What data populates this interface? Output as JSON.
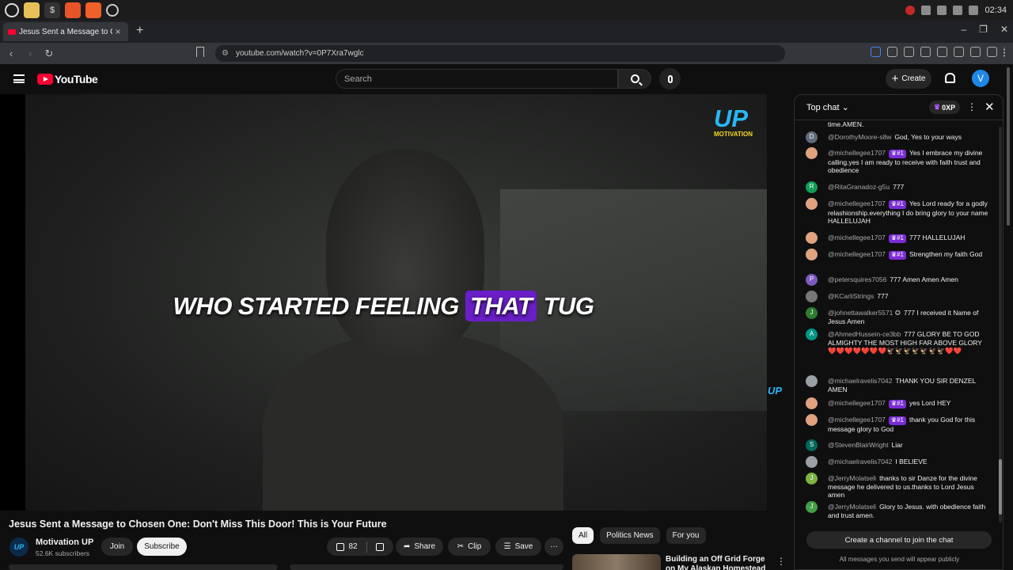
{
  "os": {
    "clock": "02:34"
  },
  "browser": {
    "tab_title": "Jesus Sent a Message to C",
    "tab_close": "×",
    "new_tab": "+",
    "url": "youtube.com/watch?v=0P7Xra7wglc",
    "win_min": "–",
    "win_max": "❐",
    "win_close": "✕"
  },
  "youtube": {
    "logo_text": "YouTube",
    "search_placeholder": "Search",
    "create_label": "Create",
    "avatar_letter": "V"
  },
  "video": {
    "caption_before": "WHO STARTED FEELING ",
    "caption_highlight": "THAT",
    "caption_after": " TUG",
    "watermark_main": "UP",
    "watermark_sub": "MOTIVATION",
    "watermark_small": "UP",
    "title": "Jesus Sent a Message to Chosen One: Don't Miss This Door! This is Your Future"
  },
  "channel": {
    "avatar_text": "UP",
    "name": "Motivation UP",
    "subscribers": "52.6K subscribers",
    "join_label": "Join",
    "subscribe_label": "Subscribe"
  },
  "actions": {
    "likes": "82",
    "share_label": "Share",
    "clip_label": "Clip",
    "save_label": "Save",
    "more": "···"
  },
  "chips": [
    "All",
    "Politics News",
    "For you"
  ],
  "recommendation": {
    "title": "Building an Off Grid Forge on My Alaskan Homestead",
    "more": "⋮"
  },
  "chat": {
    "header_label": "Top chat",
    "points": "0XP",
    "kebab": "⋮",
    "close": "✕",
    "top_fragment": "time.AMEN.",
    "messages": [
      {
        "avatar": "D",
        "author": "@DorothyMoore-s8w",
        "badge": "",
        "text": "God, Yes to your ways"
      },
      {
        "avatar": "",
        "author": "@michellegee1707",
        "badge": "♛#1",
        "text": "Yes I embrace my divine calling.yes I am ready to receive with faith trust and obedience"
      },
      {
        "avatar": "R",
        "author": "@RitaGranadoz-g5u",
        "badge": "",
        "text": "777"
      },
      {
        "avatar": "",
        "author": "@michellegee1707",
        "badge": "♛#1",
        "text": "Yes Lord ready for a godly relashionship.everything I do bring glory to your name HALLELUJAH"
      },
      {
        "avatar": "",
        "author": "@michellegee1707",
        "badge": "♛#1",
        "text": "777 HALLELUJAH"
      },
      {
        "avatar": "",
        "author": "@michellegee1707",
        "badge": "♛#1",
        "text": "Strengthen my faith God"
      },
      {
        "avatar": "P",
        "author": "@petersquires7056",
        "badge": "",
        "text": "777 Amen Amen Amen"
      },
      {
        "avatar": "",
        "author": "@KCarliStrings",
        "badge": "",
        "text": "777"
      },
      {
        "avatar": "J",
        "author": "@johnettawalker5571 ✪",
        "badge": "",
        "text": "777 I received it Name of Jesus Amen"
      },
      {
        "avatar": "A",
        "author": "@AhmedHussein-ce3bb",
        "badge": "",
        "text": "777 GLORY BE TO GOD ALMIGHTY THE MOST HIGH FAR ABOVE GLORY ❤️❤️❤️❤️❤️❤️❤️🦅🦅🦅🦅🦅🦅🦅❤️❤️"
      },
      {
        "avatar": "",
        "author": "@michaelravelis7042",
        "badge": "",
        "text": "THANK YOU SIR DENZEL AMEN"
      },
      {
        "avatar": "",
        "author": "@michellegee1707",
        "badge": "♛#1",
        "text": "yes Lord HEY"
      },
      {
        "avatar": "",
        "author": "@michellegee1707",
        "badge": "♛#1",
        "text": "thank you God for this message glory to God"
      },
      {
        "avatar": "S",
        "author": "@StevenBlairWright",
        "badge": "",
        "text": "Liar"
      },
      {
        "avatar": "",
        "author": "@michaelravelis7042",
        "badge": "",
        "text": "I BELIEVE"
      },
      {
        "avatar": "J",
        "author": "@JerryMolatseli",
        "badge": "",
        "text": "thanks to sir Danze for the divine message he delivered to us.thanks to Lord Jesus amen"
      },
      {
        "avatar": "J",
        "author": "@JerryMolatseli",
        "badge": "",
        "text": "Glory to Jesus. with obedience faith and trust amen."
      }
    ],
    "avatar_colors": [
      "#5f6b7a",
      "#e0a37e",
      "#0f9d58",
      "#e0a37e",
      "#e0a37e",
      "#e0a37e",
      "#7e57c2",
      "#777777",
      "#2e7d32",
      "#009688",
      "#9aa0a6",
      "#e0a37e",
      "#e0a37e",
      "#00695c",
      "#9aa0a6",
      "#7cb342",
      "#43a047"
    ],
    "join_label": "Create a channel to join the chat",
    "public_note": "All messages you send will appear publicly"
  }
}
